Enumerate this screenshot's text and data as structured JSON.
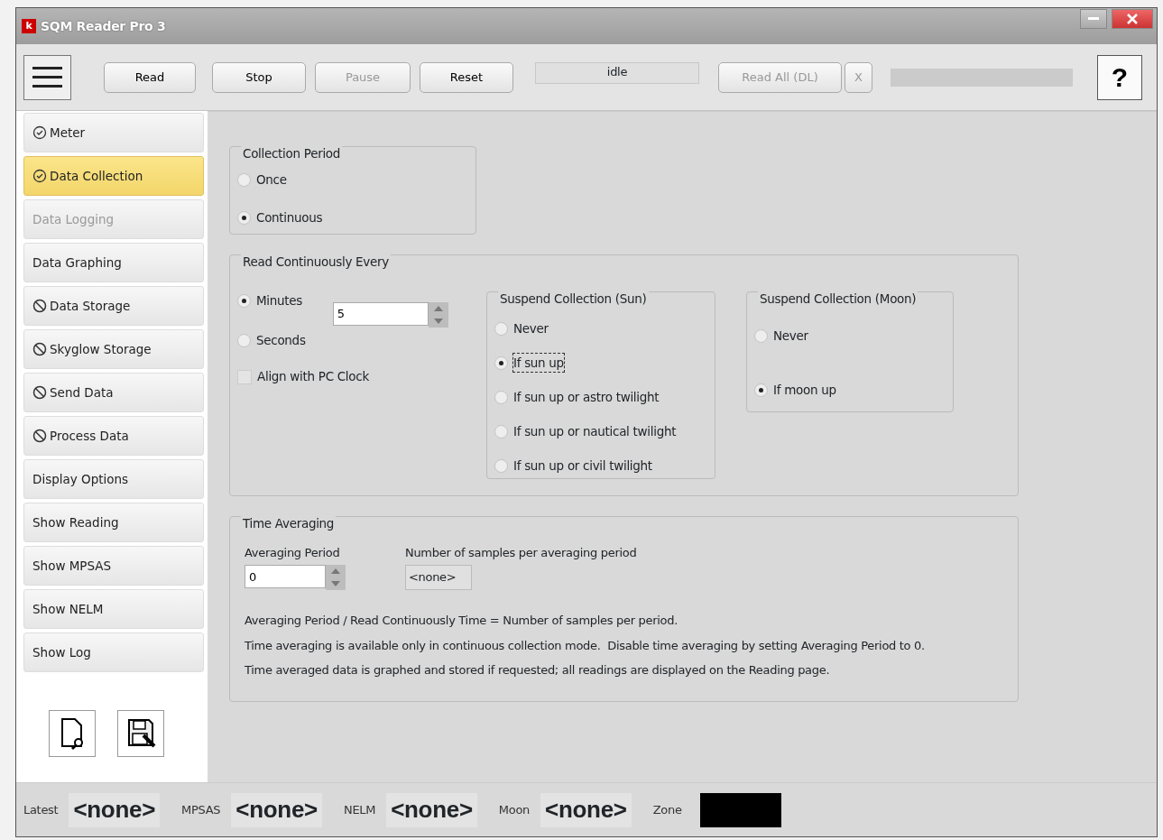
{
  "window": {
    "title": "SQM Reader Pro 3",
    "app_icon": "k"
  },
  "toolbar": {
    "buttons": [
      {
        "label": "Read",
        "disabled": false
      },
      {
        "label": "Stop",
        "disabled": false
      },
      {
        "label": "Pause",
        "disabled": true
      },
      {
        "label": "Reset",
        "disabled": false
      }
    ],
    "status": "idle",
    "read_all": {
      "label": "Read All (DL)",
      "disabled": true
    },
    "cancel": {
      "label": "X",
      "disabled": true
    },
    "help": "?"
  },
  "sidebar": {
    "items": [
      {
        "label": "Meter",
        "kind": "check",
        "selected": false,
        "disabled": false
      },
      {
        "label": "Data Collection",
        "kind": "check",
        "selected": true,
        "disabled": false
      },
      {
        "label": "Data Logging",
        "kind": "plain",
        "selected": false,
        "disabled": true
      },
      {
        "label": "Data Graphing",
        "kind": "plain",
        "selected": false,
        "disabled": false
      },
      {
        "label": "Data Storage",
        "kind": "ban",
        "selected": false,
        "disabled": false
      },
      {
        "label": "Skyglow Storage",
        "kind": "ban",
        "selected": false,
        "disabled": false
      },
      {
        "label": "Send Data",
        "kind": "ban",
        "selected": false,
        "disabled": false
      },
      {
        "label": "Process Data",
        "kind": "ban",
        "selected": false,
        "disabled": false
      },
      {
        "label": "Display Options",
        "kind": "plain",
        "selected": false,
        "disabled": false
      },
      {
        "label": "Show Reading",
        "kind": "plain",
        "selected": false,
        "disabled": false
      },
      {
        "label": "Show MPSAS",
        "kind": "plain",
        "selected": false,
        "disabled": false
      },
      {
        "label": "Show NELM",
        "kind": "plain",
        "selected": false,
        "disabled": false
      },
      {
        "label": "Show Log",
        "kind": "plain",
        "selected": false,
        "disabled": false
      }
    ],
    "tools": [
      {
        "kind": "preview"
      },
      {
        "kind": "save"
      }
    ]
  },
  "collection_period": {
    "title": "Collection Period",
    "options": [
      {
        "label": "Once",
        "selected": false
      },
      {
        "label": "Continuous",
        "selected": true
      }
    ]
  },
  "read_every": {
    "title": "Read Continuously Every",
    "units": [
      {
        "label": "Minutes",
        "selected": true
      },
      {
        "label": "Seconds",
        "selected": false
      }
    ],
    "value": "5",
    "align_clock": {
      "label": "Align with PC Clock",
      "checked": false
    },
    "sun": {
      "title": "Suspend Collection (Sun)",
      "options": [
        {
          "label": "Never",
          "selected": false,
          "focused": false
        },
        {
          "label": "If sun up",
          "selected": true,
          "focused": true
        },
        {
          "label": "If sun up or astro twilight",
          "selected": false,
          "focused": false
        },
        {
          "label": "If sun up or nautical twilight",
          "selected": false,
          "focused": false
        },
        {
          "label": "If sun up or civil twilight",
          "selected": false,
          "focused": false
        }
      ]
    },
    "moon": {
      "title": "Suspend Collection (Moon)",
      "options": [
        {
          "label": "Never",
          "selected": false
        },
        {
          "label": "If moon up",
          "selected": true
        }
      ]
    }
  },
  "time_averaging": {
    "title": "Time Averaging",
    "period_label": "Averaging Period",
    "period_value": "0",
    "samples_label": "Number of samples per averaging period",
    "samples_value": "<none>",
    "notes": [
      "Averaging Period / Read Continuously Time = Number of samples per period.",
      "Time averaging is available only in continuous collection mode.  Disable time averaging by setting Averaging Period to 0.",
      "Time averaged data is graphed and stored if requested; all readings are displayed on the Reading page."
    ]
  },
  "status_bar": [
    {
      "label": "Latest",
      "value": "<none>"
    },
    {
      "label": "MPSAS",
      "value": "<none>"
    },
    {
      "label": "NELM",
      "value": "<none>"
    },
    {
      "label": "Moon",
      "value": "<none>"
    }
  ],
  "zone": {
    "label": "Zone",
    "color": "#000000"
  }
}
